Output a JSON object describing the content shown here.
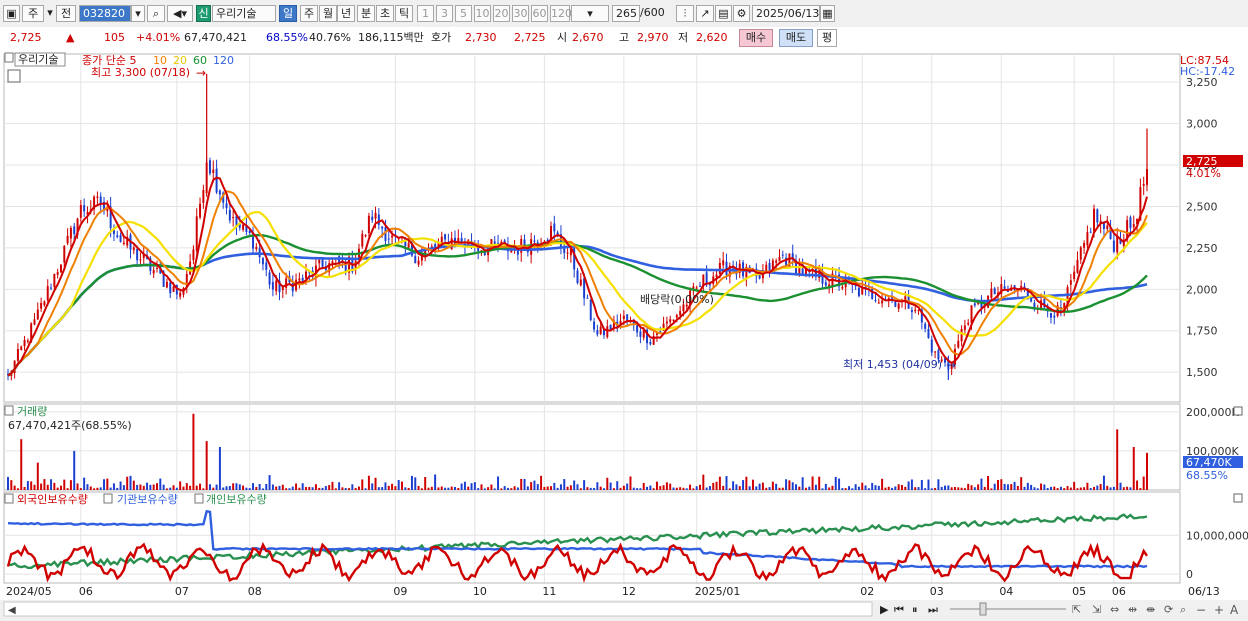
{
  "toolbar": {
    "market": "주",
    "scope": "전",
    "code": "032820",
    "stock_badge": "신",
    "stock_name": "우리기술",
    "periods": [
      "일",
      "주",
      "월",
      "년",
      "분",
      "초",
      "틱"
    ],
    "active_period": "일",
    "intervals": [
      "1",
      "3",
      "5",
      "10",
      "20",
      "30",
      "60",
      "120"
    ],
    "count": "265",
    "count_max": "/600",
    "date": "2025/06/13"
  },
  "info": {
    "price": "2,725",
    "arrow": "▲",
    "change": "105",
    "change_pct": "+4.01%",
    "volume": "67,470,421",
    "ratio1": "68.55%",
    "ratio2": "40.76%",
    "amount": "186,115백만",
    "ask_label": "호가",
    "ask1": "2,730",
    "ask2": "2,725",
    "open_label": "시",
    "open": "2,670",
    "high_label": "고",
    "high": "2,970",
    "low_label": "저",
    "low": "2,620",
    "buy": "매수",
    "sell": "매도",
    "pyeong": "평"
  },
  "colors": {
    "up": "#d00000",
    "down": "#1a3fd0",
    "ma5": "#d00000",
    "ma10": "#f08000",
    "ma20": "#f5e000",
    "ma60": "#1a9030",
    "ma120": "#3060e0",
    "foreign": "#d00000",
    "institution": "#3060e0",
    "individual": "#2a9050"
  },
  "chart_data": [
    {
      "type": "candlestick",
      "title": "우리기술",
      "legend": [
        {
          "name": "종가 단순 5",
          "color": "#d00000"
        },
        {
          "name": "10",
          "color": "#f08000"
        },
        {
          "name": "20",
          "color": "#e8c800"
        },
        {
          "name": "60",
          "color": "#1a9030"
        },
        {
          "name": "120",
          "color": "#3060e0"
        }
      ],
      "y_ticks": [
        "3,250",
        "3,000",
        "2,750",
        "2,500",
        "2,250",
        "2,000",
        "1,750",
        "1,500"
      ],
      "y_tick_values": [
        3250,
        3000,
        2750,
        2500,
        2250,
        2000,
        1750,
        1500
      ],
      "ylim": [
        1320,
        3420
      ],
      "x_labels": [
        "2024/05",
        "06",
        "07",
        "08",
        "09",
        "10",
        "11",
        "12",
        "2025/01",
        "02",
        "03",
        "04",
        "05",
        "06",
        "06/13"
      ],
      "current_price_label": "2,725",
      "current_change_label": "4.01%",
      "lc_label": "LC:87.54",
      "hc_label": "HC:-17.42",
      "annotations": {
        "high": "최고 3,300 (07/18)",
        "low": "최저 1,453 (04/09)",
        "dividend": "배당락(0.00%)"
      },
      "series_anchor": [
        [
          0,
          1480
        ],
        [
          8,
          1800
        ],
        [
          16,
          2180
        ],
        [
          22,
          2480
        ],
        [
          28,
          2520
        ],
        [
          34,
          2300
        ],
        [
          42,
          2150
        ],
        [
          52,
          1960
        ],
        [
          56,
          2250
        ],
        [
          60,
          2800
        ],
        [
          63,
          2650
        ],
        [
          68,
          2400
        ],
        [
          74,
          2300
        ],
        [
          80,
          2000
        ],
        [
          88,
          2050
        ],
        [
          96,
          2150
        ],
        [
          104,
          2150
        ],
        [
          110,
          2450
        ],
        [
          116,
          2300
        ],
        [
          124,
          2200
        ],
        [
          134,
          2300
        ],
        [
          144,
          2250
        ],
        [
          154,
          2250
        ],
        [
          164,
          2350
        ],
        [
          170,
          2200
        ],
        [
          178,
          1720
        ],
        [
          186,
          1820
        ],
        [
          194,
          1700
        ],
        [
          202,
          1850
        ],
        [
          210,
          2050
        ],
        [
          218,
          2150
        ],
        [
          226,
          2050
        ],
        [
          234,
          2200
        ],
        [
          242,
          2080
        ],
        [
          250,
          2050
        ],
        [
          258,
          1980
        ],
        [
          266,
          1950
        ],
        [
          274,
          1900
        ],
        [
          280,
          1600
        ],
        [
          284,
          1530
        ],
        [
          290,
          1840
        ],
        [
          298,
          1980
        ],
        [
          306,
          2000
        ],
        [
          312,
          1900
        ],
        [
          318,
          1850
        ],
        [
          324,
          2200
        ],
        [
          328,
          2450
        ],
        [
          334,
          2280
        ],
        [
          340,
          2400
        ],
        [
          344,
          2725
        ]
      ]
    },
    {
      "type": "bar",
      "title": "거래량",
      "volume_text": "67,470,421주(68.55%)",
      "y_ticks": [
        "200,000K",
        "100,000K"
      ],
      "y_tick_values": [
        200000,
        100000
      ],
      "current_label": "67,470K",
      "current_pct_label": "68.55%",
      "ylim": [
        0,
        220000
      ],
      "spikes": [
        [
          4,
          130000
        ],
        [
          9,
          70000
        ],
        [
          20,
          100000
        ],
        [
          56,
          195000
        ],
        [
          60,
          125000
        ],
        [
          64,
          110000
        ],
        [
          335,
          155000
        ],
        [
          340,
          110000
        ],
        [
          344,
          95000
        ]
      ]
    },
    {
      "type": "line",
      "series": [
        {
          "name": "외국인보유수량",
          "color": "#d00000"
        },
        {
          "name": "기관보유수량",
          "color": "#3060e0"
        },
        {
          "name": "개인보유수량",
          "color": "#2a9050"
        }
      ],
      "y_ticks": [
        "10,000,000",
        "0"
      ],
      "y_tick_values": [
        10000000,
        0
      ]
    }
  ]
}
